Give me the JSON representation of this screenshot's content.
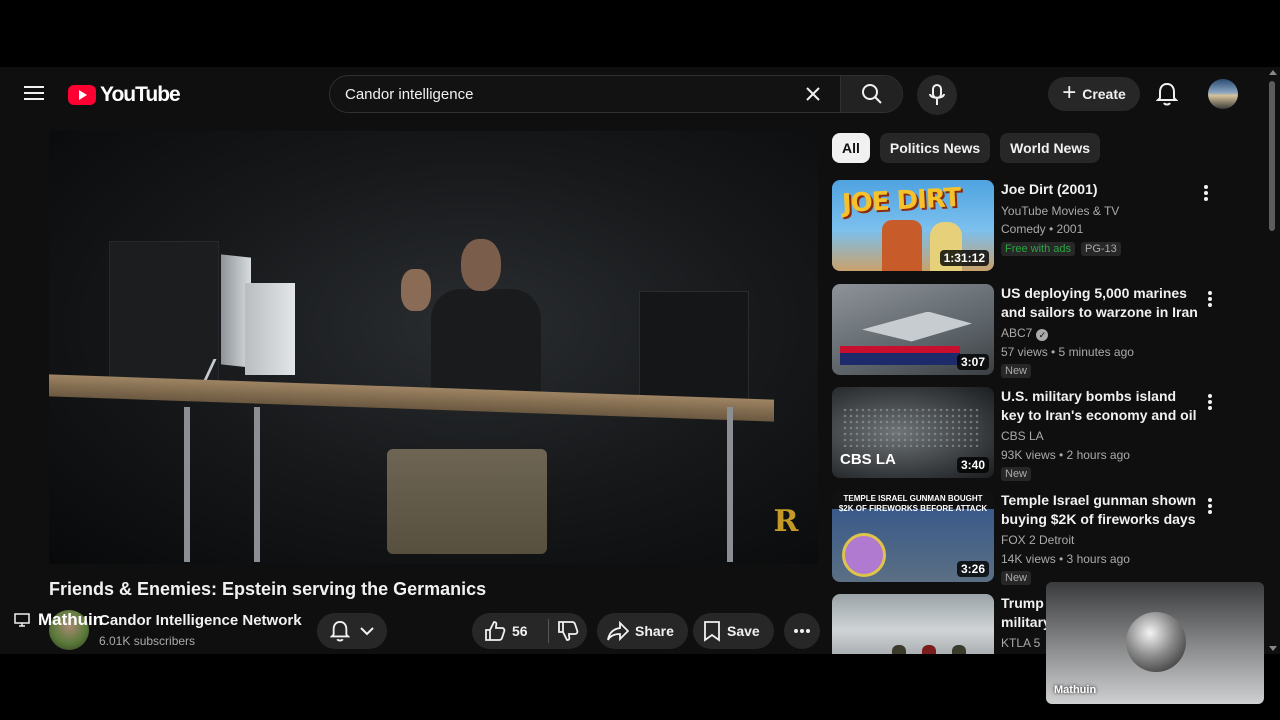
{
  "header": {
    "logo_text": "YouTube",
    "search": {
      "value": "Candor intelligence",
      "placeholder": "Search"
    },
    "create_label": "Create"
  },
  "video": {
    "title": "Friends & Enemies: Epstein serving the Germanics",
    "channel_name": "Candor Intelligence Network",
    "subscribers": "6.01K subscribers",
    "like_count": "56",
    "share_label": "Share",
    "save_label": "Save",
    "overlay_user": "Mathuin"
  },
  "chips": [
    {
      "label": "All",
      "active": true
    },
    {
      "label": "Politics News",
      "active": false
    },
    {
      "label": "World News",
      "active": false
    }
  ],
  "recommendations": [
    {
      "title": "Joe Dirt (2001)",
      "channel": "YouTube Movies & TV",
      "meta": "Comedy • 2001",
      "badge_free": "Free with ads",
      "badge_rating": "PG-13",
      "duration": "1:31:12",
      "thumb_text": "JOE DIRT"
    },
    {
      "title": "US deploying 5,000 marines and sailors to warzone in Iran as ...",
      "channel": "ABC7",
      "verified": true,
      "meta": "57 views • 5 minutes ago",
      "badge": "New",
      "duration": "3:07"
    },
    {
      "title": "U.S. military bombs island key to Iran's economy and oil ...",
      "channel": "CBS LA",
      "meta": "93K views • 2 hours ago",
      "badge": "New",
      "duration": "3:40",
      "thumb_text": "CBS LA"
    },
    {
      "title": "Temple Israel gunman shown buying $2K of fireworks days ...",
      "channel": "FOX 2 Detroit",
      "meta": "14K views • 3 hours ago",
      "badge": "New",
      "duration": "3:26",
      "thumb_text": "TEMPLE ISRAEL GUNMAN BOUGHT $2K OF FIREWORKS BEFORE ATTACK"
    },
    {
      "title": "Trump ... military ...",
      "title_visible_1": "Trump",
      "title_visible_2": "military",
      "channel": "KTLA 5"
    }
  ],
  "pip": {
    "name": "Mathuin"
  },
  "colors": {
    "brand_red": "#ff0033",
    "background": "#0f0f0f",
    "chip_bg": "#272727",
    "free_green": "#2ba640"
  }
}
